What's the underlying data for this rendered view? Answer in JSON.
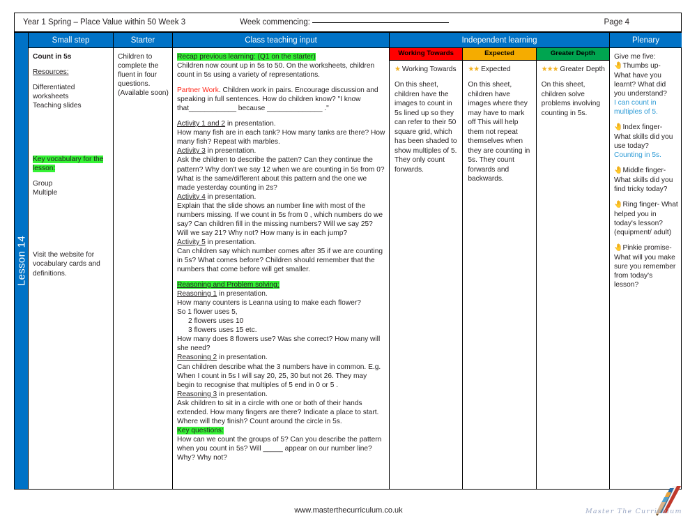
{
  "info": {
    "title": "Year 1 Spring – Place Value within 50 Week 3",
    "week_commencing_label": "Week commencing:",
    "page": "Page 4"
  },
  "spine": {
    "lesson_label": "Lesson 14"
  },
  "headers": {
    "small_step": "Small step",
    "starter": "Starter",
    "class_teaching_input": "Class teaching input",
    "independent_learning": "Independent learning",
    "plenary": "Plenary"
  },
  "colors": {
    "header_blue": "#0072C6",
    "working_towards_red": "#FF0000",
    "expected_amber": "#F5AC00",
    "greater_depth_green": "#00A550",
    "highlight_green": "#35F235",
    "accent_red_text": "#FF2A1C",
    "accent_blue_text": "#2E9BD6"
  },
  "small_step": {
    "heading": "Count in 5s",
    "resources_label": "Resources:",
    "resources": [
      "Differentiated worksheets",
      "Teaching slides"
    ],
    "key_vocab_label": "Key vocabulary for the lesson:",
    "vocab": [
      "Group",
      "Multiple"
    ],
    "website_note": "Visit the website for vocabulary cards and definitions."
  },
  "starter": {
    "text": "Children to complete the fluent in four questions. (Available soon)"
  },
  "class_teaching": {
    "recap_label": "Recap previous learning: (Q1 on the starter)",
    "recap_body": "Children now count up in 5s to 50. On the worksheets, children count in 5s using a variety of representations.",
    "partner_label": "Partner Work",
    "partner_body": ". Children work in pairs. Encourage discussion and speaking in full sentences. How do children know?  \"I know that____________ because ______________ .\"",
    "activity_1_2_label": "Activity 1 and 2",
    "activity_1_2_tail": "in presentation.",
    "activity_1_2_body": "How many fish are in each tank? How many tanks are there? How many fish?  Repeat with marbles.",
    "activity_3_label": "Activity 3",
    "activity_3_tail": "in presentation.",
    "activity_3_body": "Ask the children to describe the patten? Can they continue the pattern? Why don't we say 12 when we are counting in 5s from 0? What is the same/different about this pattern and the one we made yesterday counting in 2s?",
    "activity_4_label": "Activity 4",
    "activity_4_tail": "in presentation.",
    "activity_4_body": "Explain that the slide shows an number line with  most of the numbers missing. If we count in 5s from 0 , which numbers do we say? Can children fill in the missing numbers? Will we say 25?  Will we say 21? Why not? How many is in each jump?",
    "activity_5_label": "Activity 5",
    "activity_5_tail": "in presentation.",
    "activity_5_body": "Can children say which number comes after 35 if we are counting in 5s? What comes before? Children should remember that the numbers that come before will get smaller.",
    "reasoning_header": "Reasoning and Problem solving:",
    "reasoning_1_label": "Reasoning 1",
    "reasoning_1_tail": "in presentation.",
    "reasoning_1_body": "How many counters is Leanna using to make each flower?",
    "reasoning_1_line1": "So 1 flower uses 5,",
    "reasoning_1_line2": "2 flowers uses 10",
    "reasoning_1_line3": "3 flowers uses 15 etc.",
    "reasoning_1_body2": "How many does 8 flowers use? Was she correct? How many will she need?",
    "reasoning_2_label": "Reasoning 2",
    "reasoning_2_tail": "in presentation.",
    "reasoning_2_body": "Can children describe what the 3 numbers have in common. E.g. When I count in 5s I will say 20, 25, 30 but not 26. They may begin to recognise that multiples of 5 end in 0 or 5 .",
    "reasoning_3_label": "Reasoning 3",
    "reasoning_3_tail": "in presentation.",
    "reasoning_3_body": "Ask children to sit in a circle with one or both of their hands extended. How many fingers are there? Indicate  a place to start. Where will they finish?  Count around the circle in 5s.",
    "key_questions_label": "Key questions:",
    "key_questions_body": "How can we count the groups of 5? Can you describe the pattern when you count in 5s? Will _____ appear on our number line? Why? Why not?"
  },
  "independent": [
    {
      "head": "Working Towards",
      "head_color": "#FF0000",
      "stars": 1,
      "star_label": "Working Towards",
      "body": "On this sheet, children have the images to count in 5s lined up so they can refer to their 50 square grid, which has been shaded to show multiples of 5. They only count forwards."
    },
    {
      "head": "Expected",
      "head_color": "#F5AC00",
      "stars": 2,
      "star_label": "Expected",
      "body": "On this sheet, children have images where they may have to mark off This will help them not repeat themselves when they are counting in 5s. They count forwards and backwards."
    },
    {
      "head": "Greater Depth",
      "head_color": "#00A550",
      "stars": 3,
      "star_label": "Greater Depth",
      "body": "On this sheet, children solve problems involving counting in 5s."
    }
  ],
  "plenary": {
    "intro": "Give me five:",
    "items": [
      {
        "prompt": "Thumbs up- What have you learnt? What did you understand?",
        "answer": "I can count in multiples of 5."
      },
      {
        "prompt": "Index finger- What skills did you use today?",
        "answer": "Counting in 5s."
      },
      {
        "prompt": "Middle finger- What skills did you find tricky today?",
        "answer": ""
      },
      {
        "prompt": "Ring finger- What helped you in today's lesson? (equipment/ adult)",
        "answer": ""
      },
      {
        "prompt": "Pinkie promise- What will you make sure you remember from today's lesson?",
        "answer": ""
      }
    ]
  },
  "footer": {
    "url": "www.masterthecurriculum.co.uk",
    "logo_text": "Master The Curriculum"
  }
}
